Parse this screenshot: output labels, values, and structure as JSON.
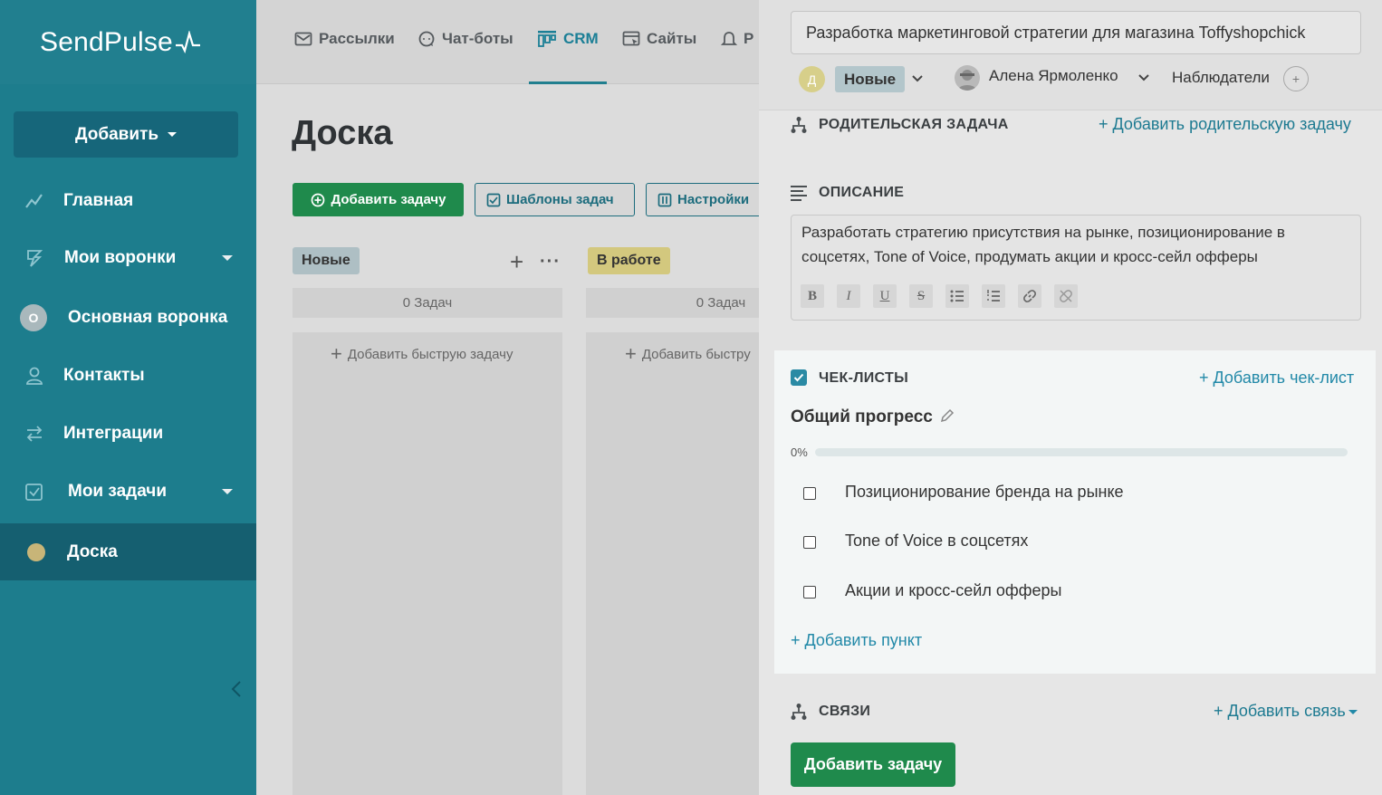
{
  "sidebar": {
    "logo": "SendPulse",
    "add_button": "Добавить",
    "items": [
      {
        "label": "Главная",
        "icon": "chart-line-icon"
      },
      {
        "label": "Мои воронки",
        "icon": "funnel-icon"
      },
      {
        "label": "Основная воронка",
        "icon": "circle-avatar-icon",
        "badge": "О"
      },
      {
        "label": "Контакты",
        "icon": "contacts-icon"
      },
      {
        "label": "Интеграции",
        "icon": "integrations-icon"
      },
      {
        "label": "Мои задачи",
        "icon": "tasks-icon"
      },
      {
        "label": "Доска",
        "icon": "board-dot-icon",
        "active": true
      }
    ]
  },
  "topnav": {
    "items": [
      {
        "label": "Рассылки",
        "icon": "mail-icon"
      },
      {
        "label": "Чат-боты",
        "icon": "chat-icon"
      },
      {
        "label": "CRM",
        "icon": "crm-icon",
        "active": true
      },
      {
        "label": "Сайты",
        "icon": "site-icon"
      },
      {
        "label": "Р",
        "icon": "bell-icon"
      }
    ]
  },
  "board": {
    "title": "Доска",
    "add_task": "Добавить задачу",
    "templates": "Шаблоны задач",
    "settings": "Настройки",
    "columns": [
      {
        "name": "Новые",
        "count": "0 Задач",
        "quick_add": "Добавить быструю задачу",
        "color": "#aebfc4"
      },
      {
        "name": "В работе",
        "count": "0 Задач",
        "quick_add": "Добавить быстру",
        "color": "#d3c87e"
      }
    ]
  },
  "task": {
    "title": "Разработка маркетинговой стратегии для магазина Toffyshopchick",
    "avatar_letter": "Д",
    "status": "Новые",
    "assignee": "Алена Ярмоленко",
    "observers": "Наблюдатели",
    "parent_label": "РОДИТЕЛЬСКАЯ ЗАДАЧА",
    "parent_add": "+ Добавить родительскую задачу",
    "description_label": "ОПИСАНИЕ",
    "description": "Разработать стратегию присутствия на рынке, позиционирование в соцсетях, Tone of Voice, продумать акции и кросс-сейл офферы",
    "format_buttons": [
      "B",
      "I",
      "U",
      "S",
      "bulleted-list",
      "numbered-list",
      "link",
      "unlink"
    ],
    "checklists_label": "ЧЕК-ЛИСТЫ",
    "checklists_add": "+ Добавить чек-лист",
    "progress_title": "Общий прогресс",
    "progress_percent": "0%",
    "progress_value": 0,
    "checklist_items": [
      "Позиционирование бренда на рынке",
      "Tone of Voice в соцсетях",
      "Акции и кросс-сейл офферы"
    ],
    "add_item": "+ Добавить пункт",
    "links_label": "СВЯЗИ",
    "links_add": "+ Добавить связь",
    "add_task_button": "Добавить задачу"
  }
}
